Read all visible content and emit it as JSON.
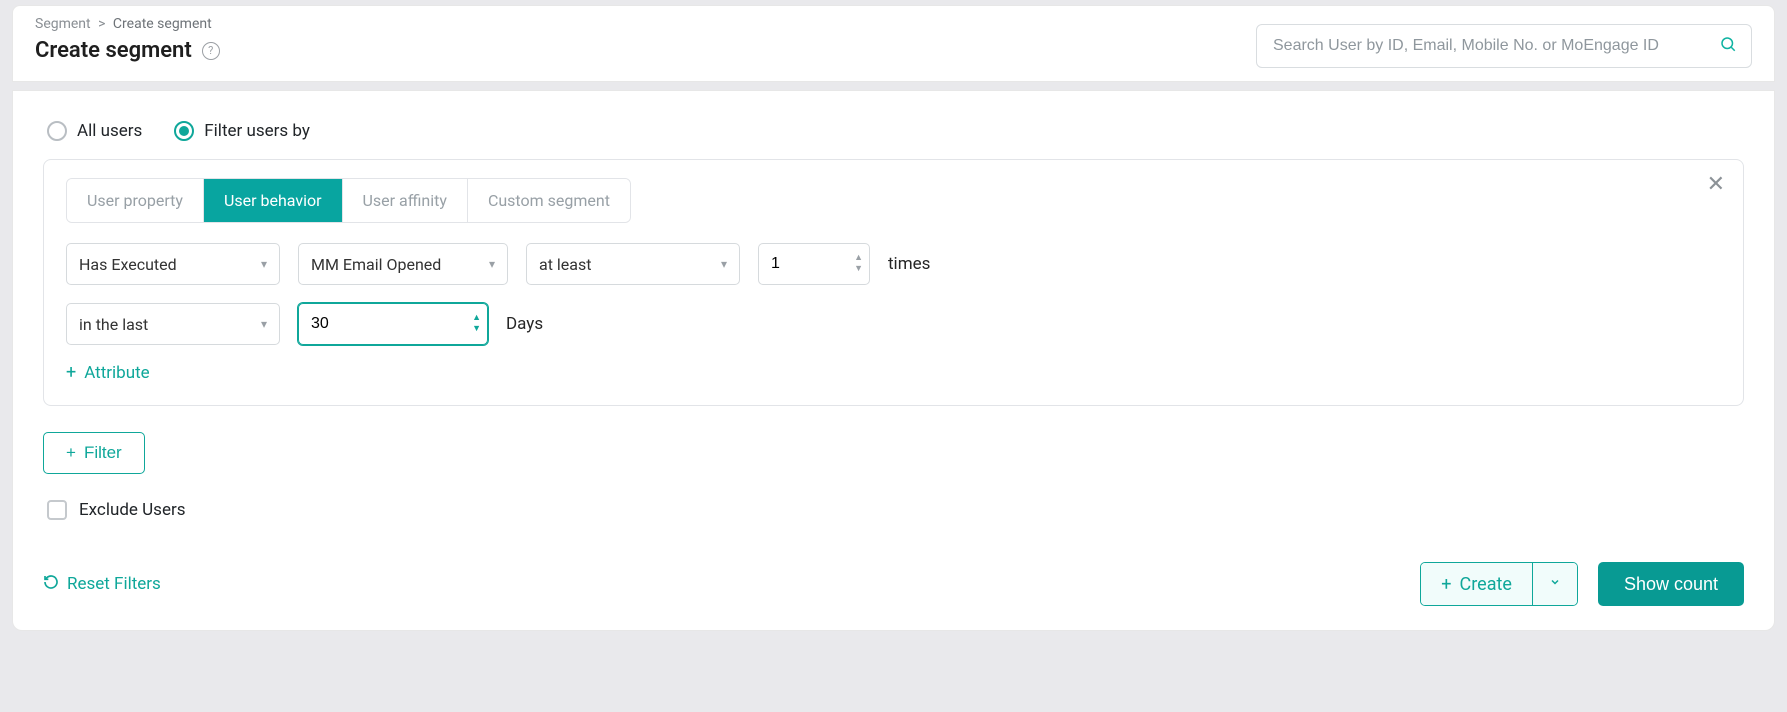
{
  "breadcrumb": {
    "root": "Segment",
    "current": "Create segment"
  },
  "page_title": "Create segment",
  "search": {
    "placeholder": "Search User by ID, Email, Mobile No. or MoEngage ID"
  },
  "radios": {
    "all_users": "All users",
    "filter_users_by": "Filter users by",
    "selected": "filter_users_by"
  },
  "tabs": {
    "user_property": "User property",
    "user_behavior": "User behavior",
    "user_affinity": "User affinity",
    "custom_segment": "Custom segment",
    "active": "user_behavior"
  },
  "condition": {
    "exec": "Has Executed",
    "event": "MM Email Opened",
    "comparator": "at least",
    "count": "1",
    "count_suffix": "times",
    "range": "in the last",
    "range_value": "30",
    "range_unit": "Days"
  },
  "links": {
    "add_attribute": "Attribute",
    "add_filter": "Filter",
    "reset_filters": "Reset Filters"
  },
  "exclude": {
    "label": "Exclude Users",
    "checked": false
  },
  "buttons": {
    "create": "Create",
    "show_count": "Show count"
  }
}
